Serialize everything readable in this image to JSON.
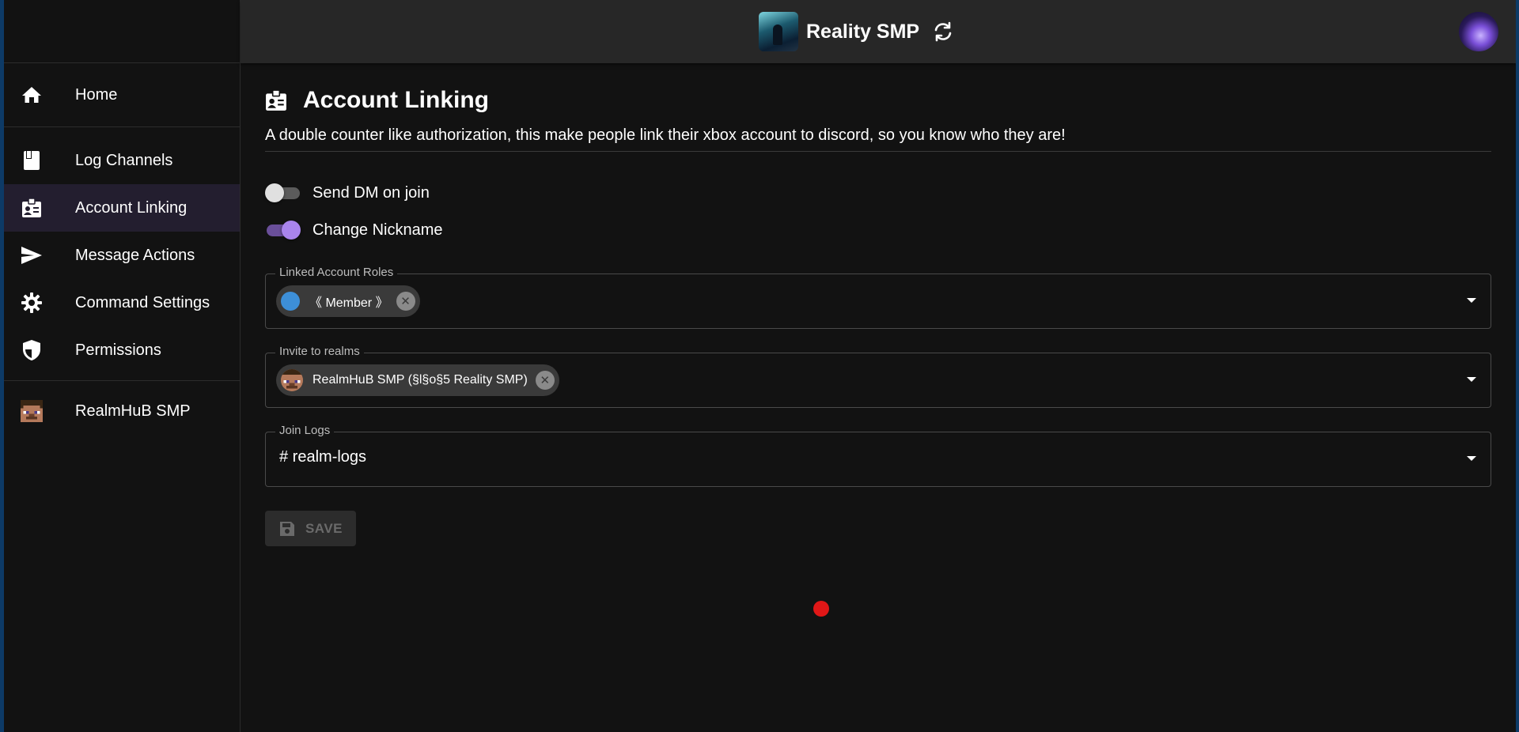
{
  "header": {
    "server_name": "Reality SMP"
  },
  "sidebar": {
    "items": [
      {
        "label": "Home",
        "icon": "home-icon"
      },
      {
        "label": "Log Channels",
        "icon": "book-icon"
      },
      {
        "label": "Account Linking",
        "icon": "id-badge-icon",
        "active": true
      },
      {
        "label": "Message Actions",
        "icon": "send-icon"
      },
      {
        "label": "Command Settings",
        "icon": "gear-icon"
      },
      {
        "label": "Permissions",
        "icon": "shield-icon"
      },
      {
        "label": "RealmHuB SMP",
        "icon": "minecraft-avatar-icon"
      }
    ]
  },
  "main": {
    "title": "Account Linking",
    "description": "A double counter like authorization, this make people link their xbox account to discord, so you know who they are!",
    "toggles": [
      {
        "label": "Send DM on join",
        "on": false
      },
      {
        "label": "Change Nickname",
        "on": true
      }
    ],
    "linked_roles": {
      "legend": "Linked Account Roles",
      "chip_label": "《 Member 》",
      "chip_color": "#3d8fd8"
    },
    "invite_realms": {
      "legend": "Invite to realms",
      "chip_label": "RealmHuB SMP (§l§o§5 Reality SMP)"
    },
    "join_logs": {
      "legend": "Join Logs",
      "value": "# realm-logs"
    },
    "save_label": "SAVE"
  },
  "colors": {
    "accent": "#a984ec",
    "active_nav_bg": "#231e2f",
    "background": "#121212",
    "header_bg": "#272727"
  }
}
